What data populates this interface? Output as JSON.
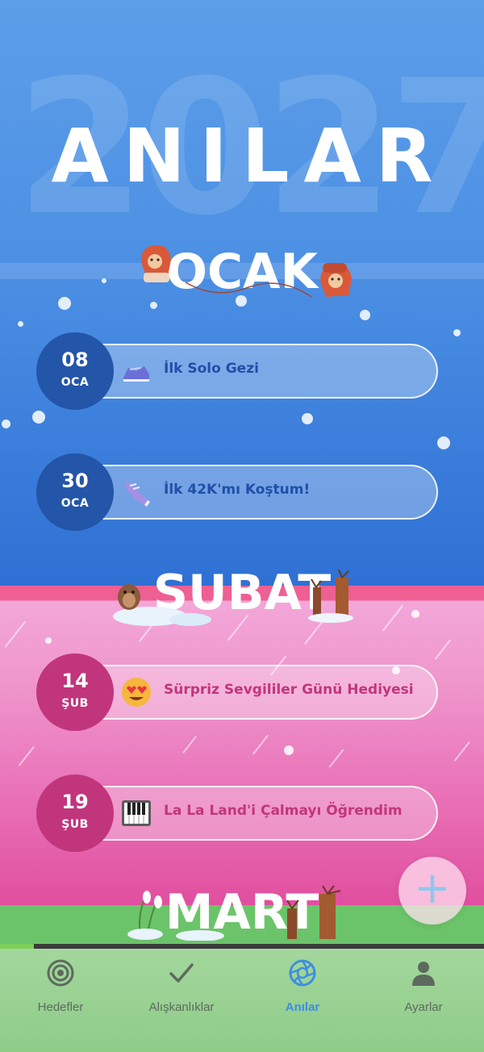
{
  "page": {
    "title": "ANILAR",
    "year": "2027"
  },
  "months": [
    {
      "name": "OCAK",
      "memories": [
        {
          "day": "08",
          "month": "OCA",
          "label": "İlk Solo Gezi",
          "emoji": "sneaker-icon"
        },
        {
          "day": "30",
          "month": "OCA",
          "label": "İlk 42K'mı Koştum!",
          "emoji": "running-shoe-icon"
        }
      ]
    },
    {
      "name": "ŞUBAT",
      "memories": [
        {
          "day": "14",
          "month": "ŞUB",
          "label": "Sürpriz Sevgililer Günü Hediyesi",
          "emoji": "heart-eyes-emoji-icon"
        },
        {
          "day": "19",
          "month": "ŞUB",
          "label": "La La Land'i Çalmayı Öğrendim",
          "emoji": "piano-icon"
        }
      ]
    },
    {
      "name": "MART",
      "memories": []
    }
  ],
  "fab": {
    "label": "+"
  },
  "progress": 0.07,
  "tabs": [
    {
      "label": "Hedefler",
      "icon": "target-icon",
      "active": false
    },
    {
      "label": "Alışkanlıklar",
      "icon": "checkmark-icon",
      "active": false
    },
    {
      "label": "Anılar",
      "icon": "aperture-icon",
      "active": true
    },
    {
      "label": "Ayarlar",
      "icon": "user-icon",
      "active": false
    }
  ],
  "colors": {
    "jan_bg": "#4c90e4",
    "feb_bg": "#e971b8",
    "mar_bg": "#6cc46a",
    "jan_accent": "#2355a8",
    "feb_accent": "#c1357c",
    "tab_active": "#3f8ee0"
  }
}
